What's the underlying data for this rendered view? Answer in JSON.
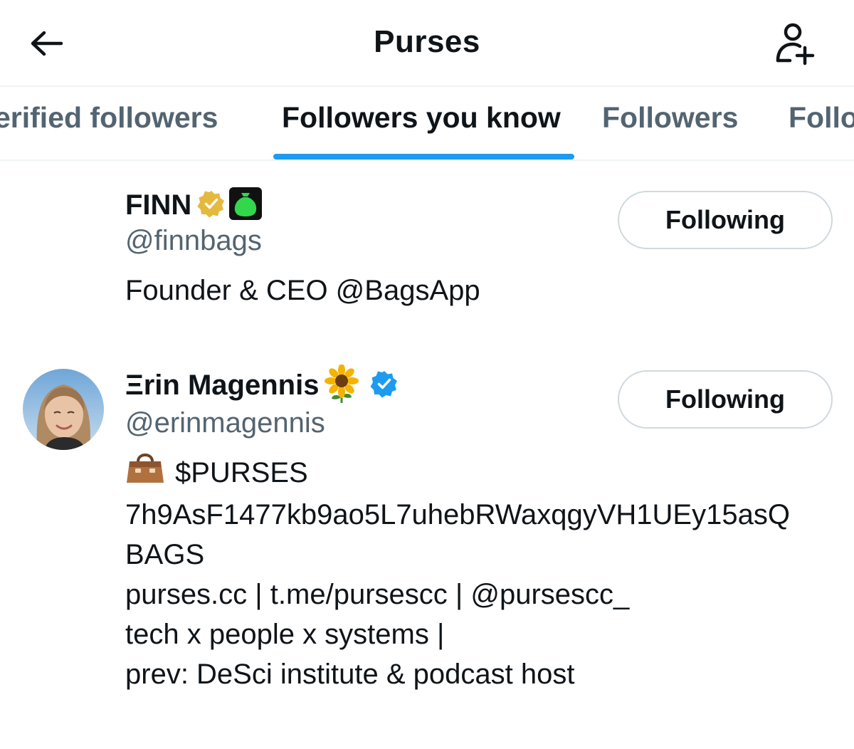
{
  "header": {
    "title": "Purses"
  },
  "tabs": [
    {
      "label": "erified followers"
    },
    {
      "label": "Followers you know"
    },
    {
      "label": "Followers"
    },
    {
      "label": "Follo"
    }
  ],
  "active_tab": "Followers you know",
  "colors": {
    "accent": "#1d9bf0",
    "gold_badge": "#e5b93d",
    "secondary_text": "#536471",
    "border": "#cfd9de"
  },
  "users": [
    {
      "name": "FINN",
      "badges": [
        "gold-verified-icon",
        "bag-affiliate-icon"
      ],
      "handle": "@finnbags",
      "bio": [
        "Founder & CEO @BagsApp"
      ],
      "button": "Following"
    },
    {
      "name": "Ξrin Magennis",
      "name_emoji": "sunflower-icon",
      "badges": [
        "blue-verified-icon"
      ],
      "handle": "@erinmagennis",
      "bio_emoji": "handbag-icon",
      "bio": [
        "$PURSES",
        "7h9AsF1477kb9ao5L7uhebRWaxqgyVH1UEy15asQ",
        "BAGS",
        "purses.cc | t.me/pursescc | @pursescc_",
        "tech x people x systems |",
        "prev: DeSci institute & podcast host"
      ],
      "button": "Following"
    }
  ]
}
